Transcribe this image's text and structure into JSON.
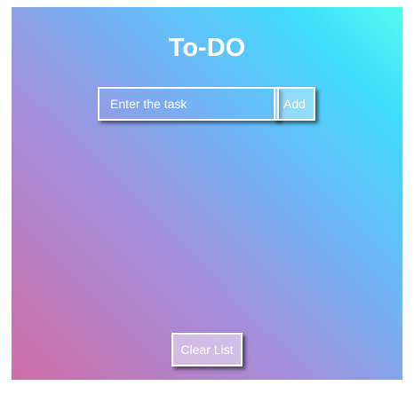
{
  "app": {
    "title": "To-DO"
  },
  "task_input": {
    "placeholder": "Enter the task",
    "value": ""
  },
  "add_button": {
    "label": "Add"
  },
  "clear_button": {
    "label": "Clear List"
  },
  "tasks": []
}
